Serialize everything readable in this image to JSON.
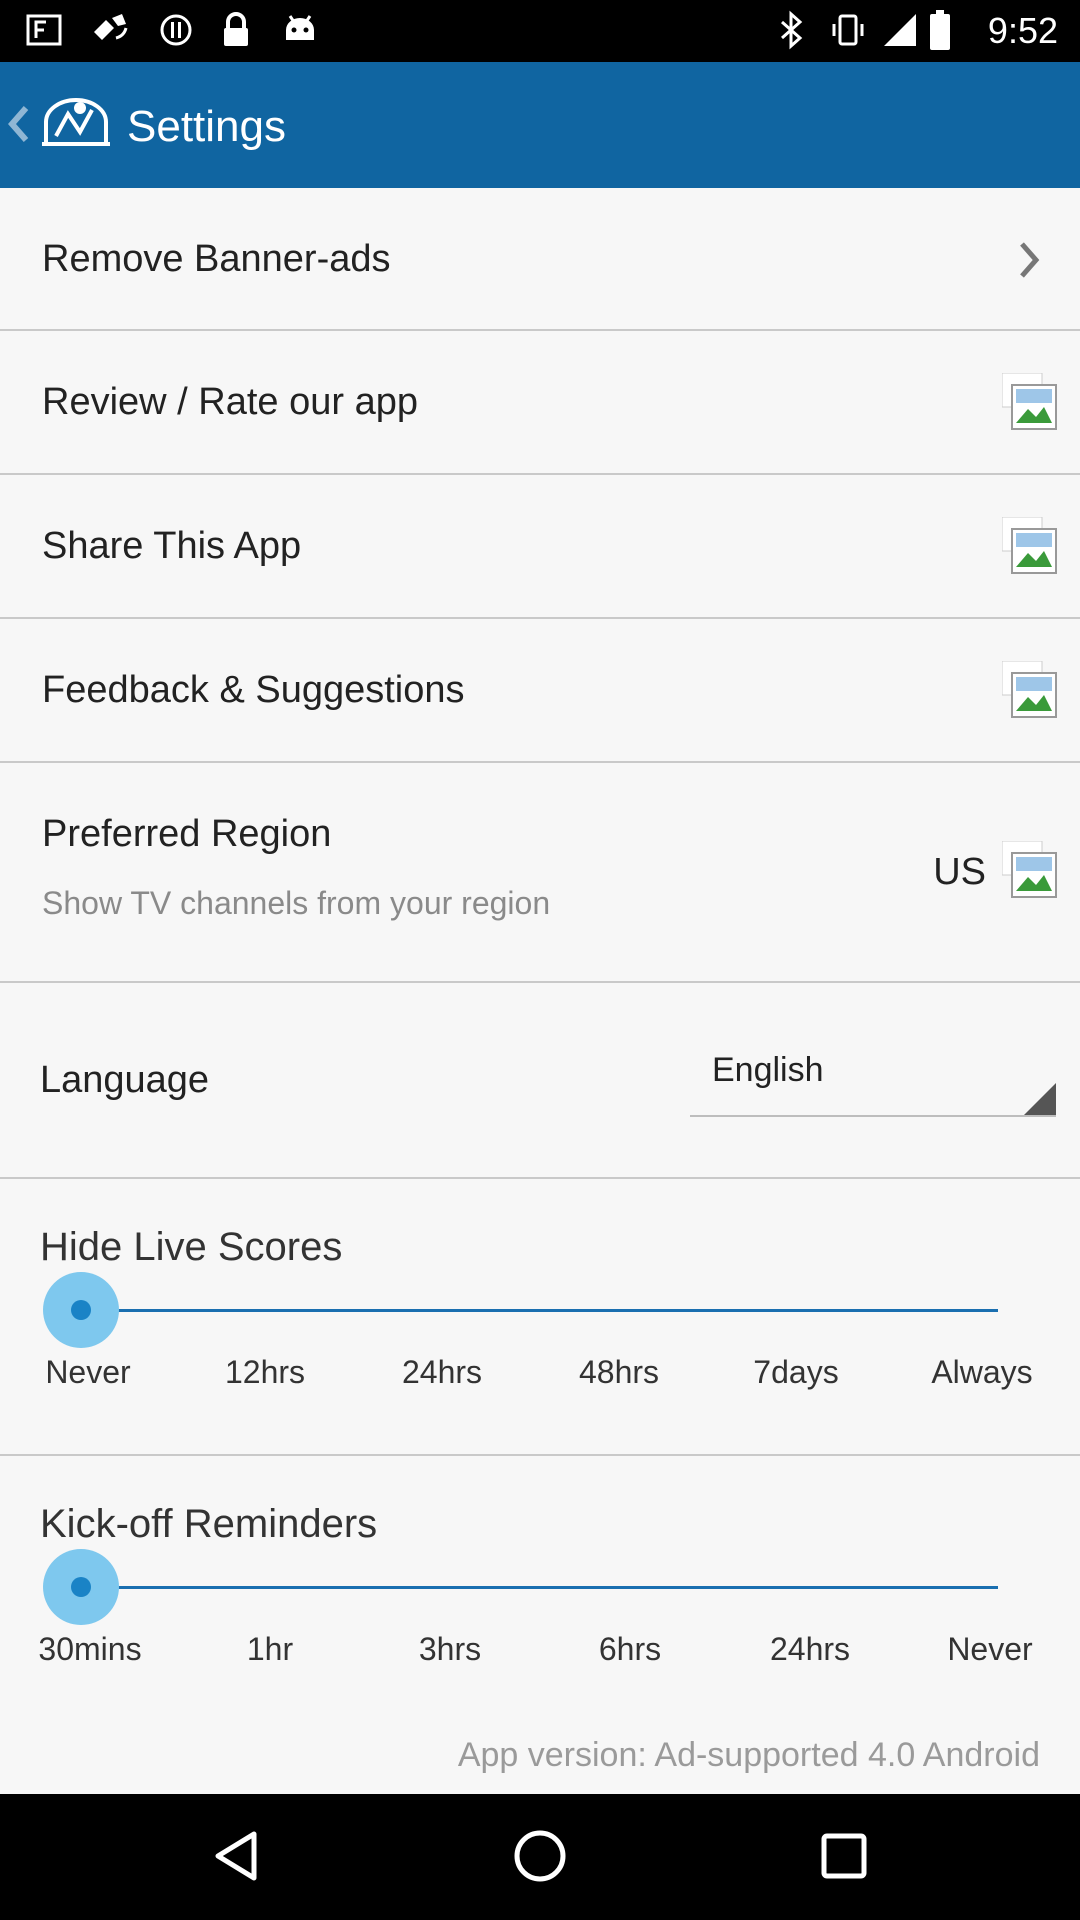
{
  "status_bar": {
    "time": "9:52",
    "left_icons": [
      "fake-gps-icon",
      "satellite-icon",
      "notification-icon",
      "lock-icon",
      "android-icon"
    ],
    "right_icons": [
      "bluetooth-icon",
      "vibrate-icon",
      "signal-icon",
      "battery-icon"
    ]
  },
  "app_bar": {
    "title": "Settings",
    "back_icon": "chevron-left-icon",
    "logo_icon": "stadium-logo-icon",
    "color": "#1065a1"
  },
  "settings": {
    "remove_ads": "Remove Banner-ads",
    "review": "Review / Rate our app",
    "share": "Share This App",
    "feedback": "Feedback & Suggestions",
    "region": {
      "label": "Preferred Region",
      "sublabel": "Show TV channels from your region",
      "value": "US"
    },
    "language": {
      "label": "Language",
      "value": "English"
    }
  },
  "hide_live_scores": {
    "title": "Hide Live Scores",
    "options": [
      "Never",
      "12hrs",
      "24hrs",
      "48hrs",
      "7days",
      "Always"
    ],
    "selected": "Never"
  },
  "kickoff_reminders": {
    "title": "Kick-off Reminders",
    "options": [
      "30mins",
      "1hr",
      "3hrs",
      "6hrs",
      "24hrs",
      "Never"
    ],
    "selected": "30mins"
  },
  "footer": {
    "app_version": "App version: Ad-supported 4.0 Android"
  },
  "nav_bar": {
    "buttons": [
      "back-triangle-icon",
      "home-circle-icon",
      "recents-square-icon"
    ]
  }
}
